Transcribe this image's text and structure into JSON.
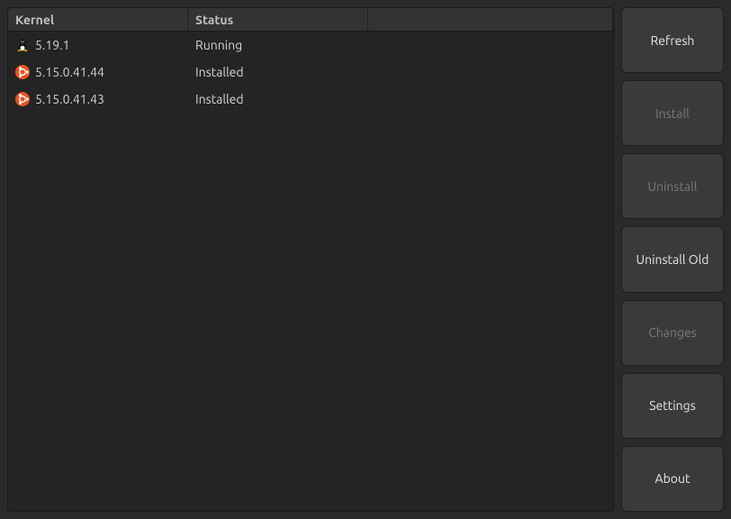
{
  "table": {
    "headers": {
      "kernel": "Kernel",
      "status": "Status"
    },
    "rows": [
      {
        "icon": "tux",
        "kernel": "5.19.1",
        "status": "Running"
      },
      {
        "icon": "ubuntu",
        "kernel": "5.15.0.41.44",
        "status": "Installed"
      },
      {
        "icon": "ubuntu",
        "kernel": "5.15.0.41.43",
        "status": "Installed"
      }
    ]
  },
  "buttons": {
    "refresh": "Refresh",
    "install": "Install",
    "uninstall": "Uninstall",
    "uninstall_old": "Uninstall Old",
    "changes": "Changes",
    "settings": "Settings",
    "about": "About"
  }
}
